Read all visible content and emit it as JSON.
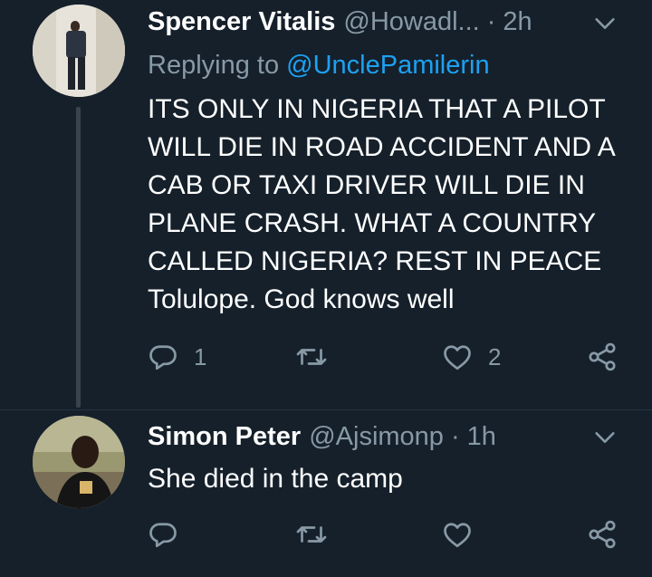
{
  "tweets": [
    {
      "name": "Spencer Vitalis",
      "handle": "@Howadl...",
      "separator": "·",
      "time": "2h",
      "reply_prefix": "Replying to ",
      "reply_mention": "@UnclePamilerin",
      "text": "ITS ONLY IN NIGERIA THAT A PILOT WILL DIE IN ROAD ACCIDENT AND A CAB OR TAXI DRIVER WILL DIE IN PLANE CRASH. WHAT A COUNTRY CALLED NIGERIA? REST IN PEACE Tolulope. God knows well",
      "reply_count": "1",
      "retweet_count": "",
      "like_count": "2"
    },
    {
      "name": "Simon Peter",
      "handle": "@Ajsimonp",
      "separator": "·",
      "time": "1h",
      "text": "She died in the camp",
      "reply_count": "",
      "retweet_count": "",
      "like_count": ""
    }
  ],
  "colors": {
    "background": "#15202b",
    "secondary_text": "#8899a6",
    "mention": "#1da1f2",
    "thread_line": "#38444d"
  },
  "icons": [
    "reply-icon",
    "retweet-icon",
    "like-icon",
    "share-icon",
    "chevron-down-icon"
  ]
}
